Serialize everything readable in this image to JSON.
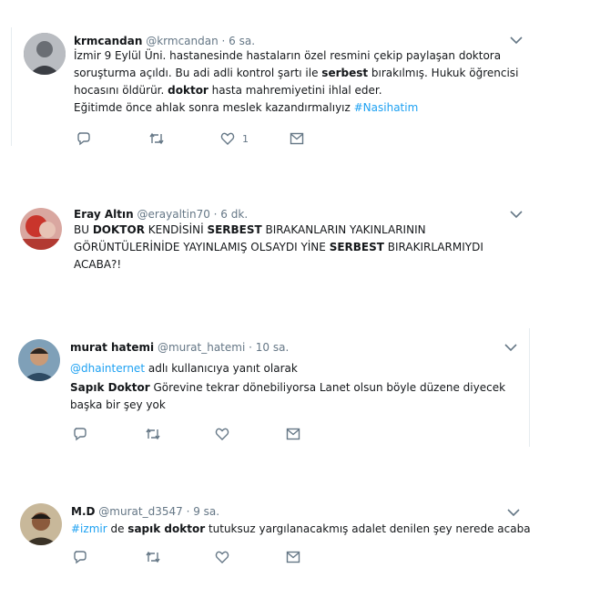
{
  "tweets": [
    {
      "name": "krmcandan",
      "handle": "@krmcandan",
      "time": "· 6 sa.",
      "line1": "İzmir 9 Eylül Üni. hastanesinde hastaların özel resmini çekip paylaşan doktora",
      "line2a": "soruşturma açıldı. Bu adi adli kontrol şartı ile ",
      "line2b": "serbest",
      "line2c": " bırakılmış. Hukuk öğrencisi",
      "line3a": "hocasını öldürür. ",
      "line3b": "doktor",
      "line3c": " hasta mahremiyetini ihlal eder.",
      "line4a": "Eğitimde önce ahlak sonra meslek kazandırmalıyız ",
      "line4b": "#Nasihatim",
      "like_count": "1"
    },
    {
      "name": "Eray Altın",
      "handle": "@erayaltin70",
      "time": "· 6 dk.",
      "l1a": "BU ",
      "l1b": "DOKTOR",
      "l1c": " KENDİSİNİ ",
      "l1d": "SERBEST",
      "l1e": " BIRAKANLARIN YAKINLARININ",
      "l2a": "GÖRÜNTÜLERİNİDE YAYINLAMIŞ OLSAYDI YİNE ",
      "l2b": "SERBEST",
      "l2c": " BIRAKIRLARMIYDI",
      "l3": "ACABA?!"
    },
    {
      "name": "murat hatemi",
      "handle": "@murat_hatemi",
      "time": "· 10 sa.",
      "reply_mention": "@dhainternet",
      "reply_suffix": " adlı kullanıcıya yanıt olarak",
      "l1a": "Sapık Doktor",
      "l1b": " Görevine tekrar dönebiliyorsa Lanet olsun böyle düzene diyecek",
      "l2": "başka bir şey yok"
    },
    {
      "name": "M.D",
      "handle": "@murat_d3547",
      "time": "· 9 sa.",
      "l1a": "#izmir",
      "l1b": " de ",
      "l1c": "sapık doktor",
      "l1d": " tutuksuz yargılanacakmış adalet denilen şey nerede acaba"
    }
  ],
  "icons": [
    "reply-icon",
    "retweet-icon",
    "like-icon",
    "dm-icon",
    "chevron-down-icon"
  ],
  "colors": {
    "link": "#1da1f2",
    "muted": "#657786",
    "text": "#14171a"
  }
}
